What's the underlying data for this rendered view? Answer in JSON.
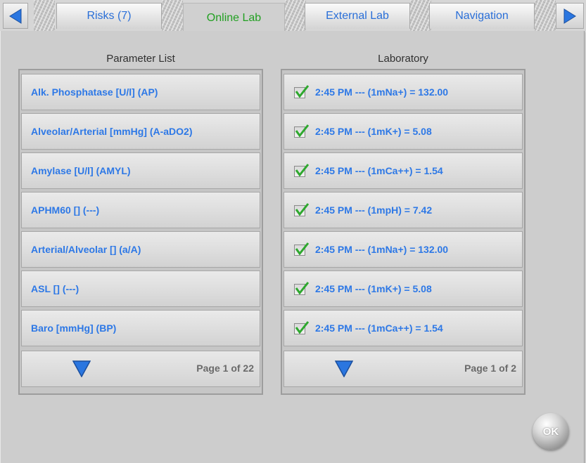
{
  "tabs": {
    "items": [
      {
        "label": "Risks (7)"
      },
      {
        "label": "Online Lab",
        "active": true
      },
      {
        "label": "External Lab"
      },
      {
        "label": "Navigation"
      }
    ],
    "prev_icon": "left-arrow-icon",
    "next_icon": "right-arrow-icon"
  },
  "parameter_list": {
    "title": "Parameter List",
    "items": [
      {
        "label": "Alk. Phosphatase [U/l] (AP)"
      },
      {
        "label": "Alveolar/Arterial [mmHg] (A-aDO2)"
      },
      {
        "label": "Amylase [U/l] (AMYL)"
      },
      {
        "label": "APHM60 [] (---)"
      },
      {
        "label": "Arterial/Alveolar [] (a/A)"
      },
      {
        "label": "ASL [] (---)"
      },
      {
        "label": "Baro [mmHg] (BP)"
      }
    ],
    "page_info": "Page 1 of 22"
  },
  "laboratory": {
    "title": "Laboratory",
    "items": [
      {
        "label": "2:45 PM --- (1mNa+) = 132.00",
        "checked": true
      },
      {
        "label": "2:45 PM --- (1mK+) = 5.08",
        "checked": true
      },
      {
        "label": "2:45 PM --- (1mCa++) = 1.54",
        "checked": true
      },
      {
        "label": "2:45 PM --- (1mpH) = 7.42",
        "checked": true
      },
      {
        "label": "2:45 PM --- (1mNa+) = 132.00",
        "checked": true
      },
      {
        "label": "2:45 PM --- (1mK+) = 5.08",
        "checked": true
      },
      {
        "label": "2:45 PM --- (1mCa++) = 1.54",
        "checked": true
      }
    ],
    "page_info": "Page 1 of 2"
  },
  "ok_button": {
    "label": "OK"
  },
  "colors": {
    "accent": "#2d78e6",
    "active_tab": "#22a022",
    "check": "#2ea82e"
  }
}
